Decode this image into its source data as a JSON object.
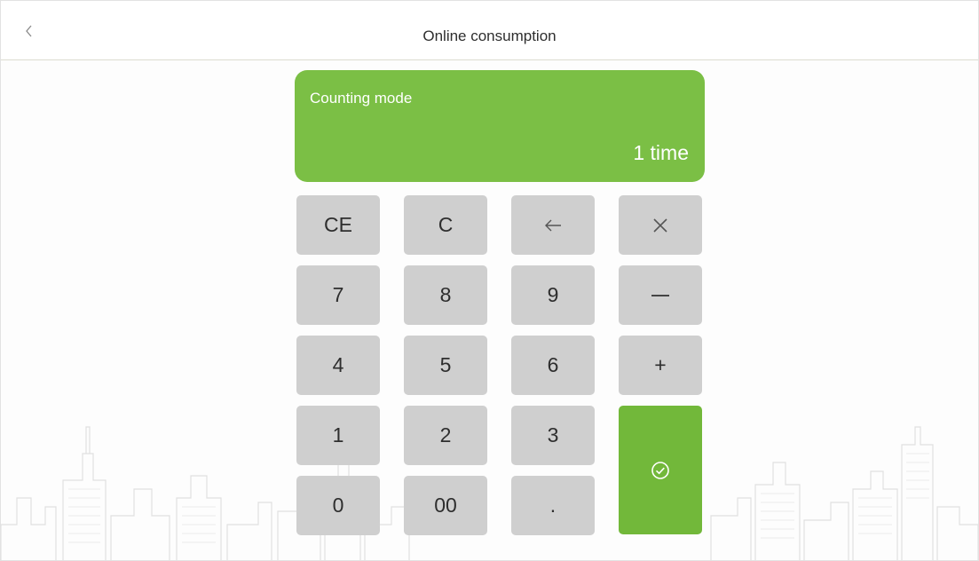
{
  "header": {
    "title": "Online consumption",
    "back_icon": "chevron-left-icon"
  },
  "display": {
    "mode_label": "Counting mode",
    "value": "1 time",
    "color": "#7bbf45"
  },
  "keypad": {
    "ce": "CE",
    "c": "C",
    "backspace_icon": "arrow-left-icon",
    "multiply_icon": "multiply-icon",
    "seven": "7",
    "eight": "8",
    "nine": "9",
    "minus_icon": "minus-icon",
    "four": "4",
    "five": "5",
    "six": "6",
    "plus": "+",
    "one": "1",
    "two": "2",
    "three": "3",
    "zero": "0",
    "double_zero": "00",
    "dot": ".",
    "confirm_icon": "check-circle-icon",
    "confirm_color": "#72b83a",
    "key_color": "#cfcfcf"
  },
  "background": {
    "decoration_icon": "city-skyline-icon"
  }
}
